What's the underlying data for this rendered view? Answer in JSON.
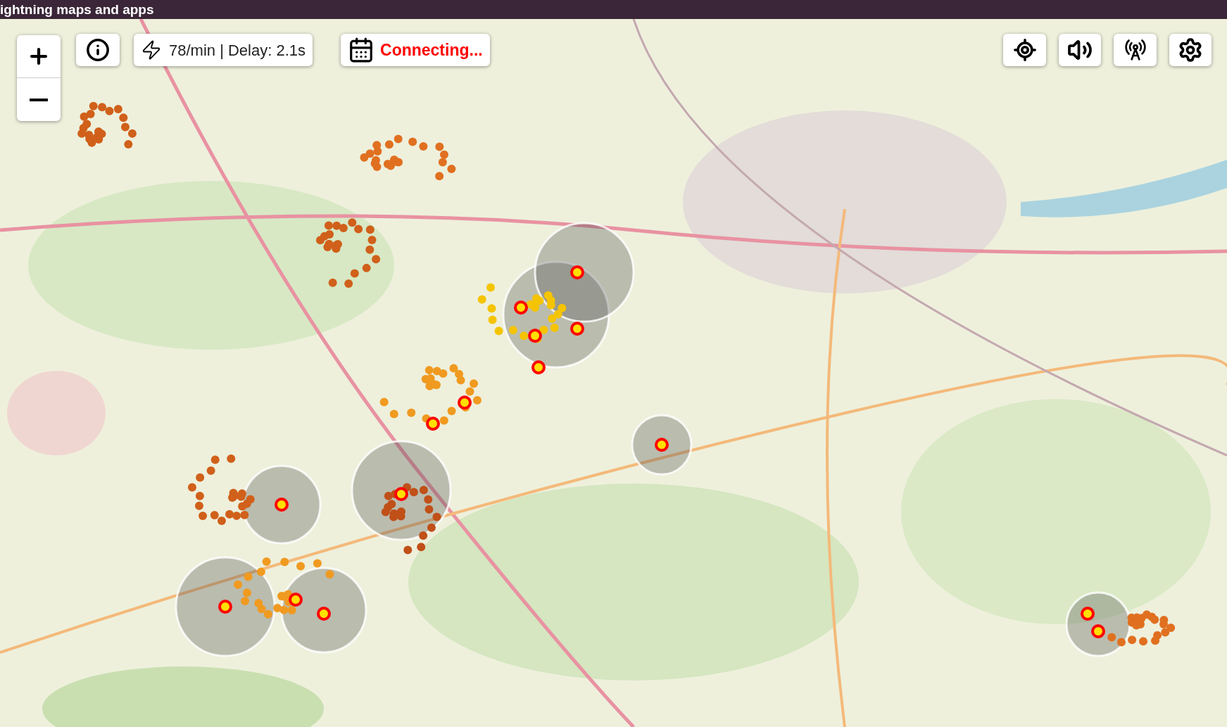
{
  "header": {
    "title": "ightning maps and apps"
  },
  "stats": {
    "text": "78/min | Delay: 2.1s"
  },
  "status": {
    "text": "Connecting..."
  }
}
